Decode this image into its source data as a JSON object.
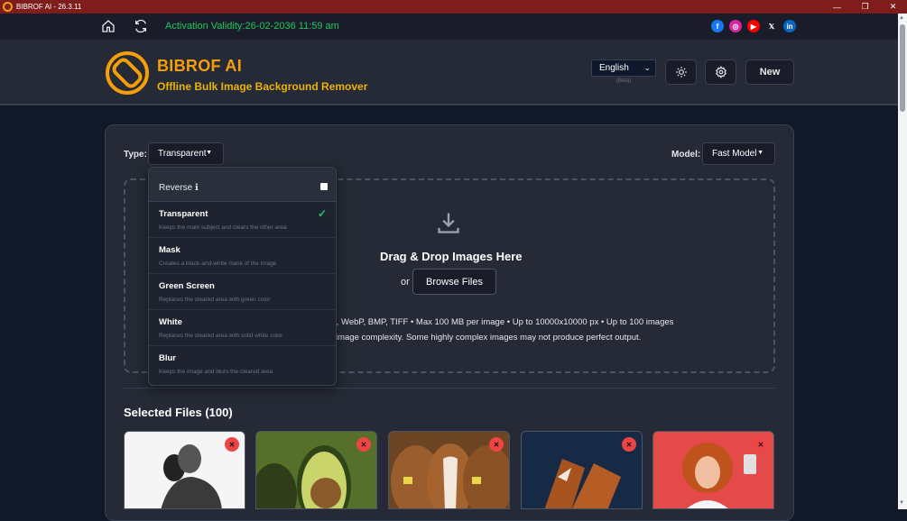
{
  "window": {
    "title": "BIBROF AI - 26.3.11",
    "controls": [
      "—",
      "❐",
      "✕"
    ]
  },
  "nav": {
    "validity": "Activation Validity:26-02-2036 11:59 am",
    "socials": [
      {
        "name": "facebook",
        "glyph": "f",
        "color": "#1877f2"
      },
      {
        "name": "instagram",
        "glyph": "◎",
        "color": "#d6249f"
      },
      {
        "name": "youtube",
        "glyph": "▶",
        "color": "#ff0000"
      },
      {
        "name": "x",
        "glyph": "𝕏",
        "color": "#000000"
      },
      {
        "name": "linkedin",
        "glyph": "in",
        "color": "#0a66c2"
      }
    ]
  },
  "header": {
    "brand": "BIBROF AI",
    "tagline": "Offline Bulk Image Background Remover",
    "language": "English",
    "beta": "(Beta)",
    "new_label": "New"
  },
  "controls": {
    "type_label": "Type:",
    "type_value": "Transparent",
    "model_label": "Model:",
    "model_value": "Fast Model"
  },
  "dropzone": {
    "title": "Drag & Drop Images Here",
    "or": "or",
    "browse": "Browse Files",
    "info_line1": "s, WebP, BMP, TIFF • Max 100 MB per image • Up to 10000x10000 px • Up to 100 images",
    "info_line2": "image complexity. Some highly complex images may not produce perfect output."
  },
  "menu": {
    "reverse_label": "Reverse ℹ",
    "items": [
      {
        "name": "Transparent",
        "desc": "Keeps the main subject and clears the other area",
        "selected": true
      },
      {
        "name": "Mask",
        "desc": "Creates a black-and-white mask of the image",
        "selected": false
      },
      {
        "name": "Green Screen",
        "desc": "Replaces the cleared area with green color",
        "selected": false
      },
      {
        "name": "White",
        "desc": "Replaces the cleared area with solid white color",
        "selected": false
      },
      {
        "name": "Blur",
        "desc": "Keeps the image and blurs the cleared area",
        "selected": false
      }
    ]
  },
  "files": {
    "title": "Selected Files (100)",
    "thumbnails": [
      {
        "subject": "man-portrait",
        "bg": "#f5f5f5"
      },
      {
        "subject": "avocado",
        "bg": "#6b8f3a"
      },
      {
        "subject": "cow",
        "bg": "#8b5a2b"
      },
      {
        "subject": "shoes",
        "bg": "#1e3a5f"
      },
      {
        "subject": "woman-selfie",
        "bg": "#e63b3b"
      }
    ]
  },
  "colors": {
    "accent": "#f59e0b",
    "validity": "#22c55e",
    "remove": "#ef4444"
  }
}
